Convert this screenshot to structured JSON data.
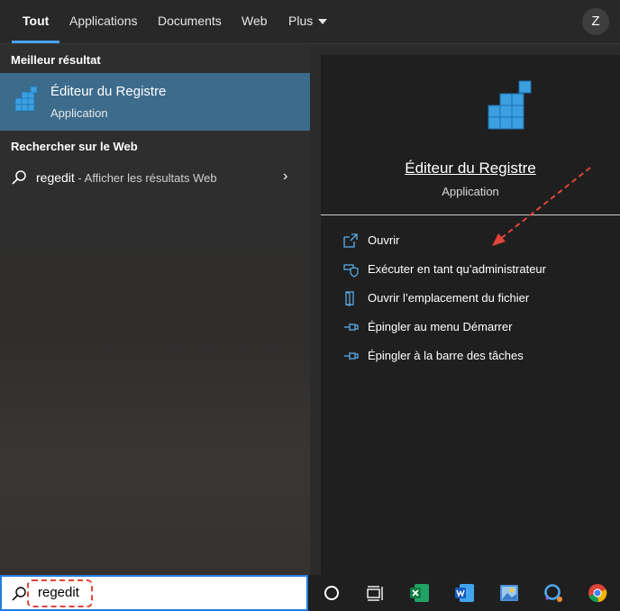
{
  "tabs": {
    "all": "Tout",
    "applications": "Applications",
    "documents": "Documents",
    "web": "Web",
    "more": "Plus",
    "avatar": "Z"
  },
  "left": {
    "best_result_title": "Meilleur résultat",
    "best_result": {
      "name": "Éditeur du Registre",
      "type": "Application",
      "icon": "registry-editor-icon"
    },
    "web_section_title": "Rechercher sur le Web",
    "web_result": {
      "query": "regedit",
      "hint": " - Afficher les résultats Web"
    }
  },
  "detail": {
    "name": "Éditeur du Registre",
    "type": "Application",
    "actions": [
      {
        "label": "Ouvrir",
        "icon": "open-icon"
      },
      {
        "label": "Exécuter en tant qu’administrateur",
        "icon": "shield-icon"
      },
      {
        "label": "Ouvrir l’emplacement du fichier",
        "icon": "folder-icon"
      },
      {
        "label": "Épingler au menu Démarrer",
        "icon": "pin-icon"
      },
      {
        "label": "Épingler à la barre des tâches",
        "icon": "pin-icon"
      }
    ]
  },
  "search": {
    "value": "regedit"
  },
  "taskbar": [
    "cortana-icon",
    "task-view-icon",
    "excel-icon",
    "word-icon",
    "photos-icon",
    "feedback-icon",
    "chrome-icon"
  ],
  "colors": {
    "accent": "#4aa3f0",
    "selection": "#3c6b8c",
    "annotation": "#e0443a"
  }
}
